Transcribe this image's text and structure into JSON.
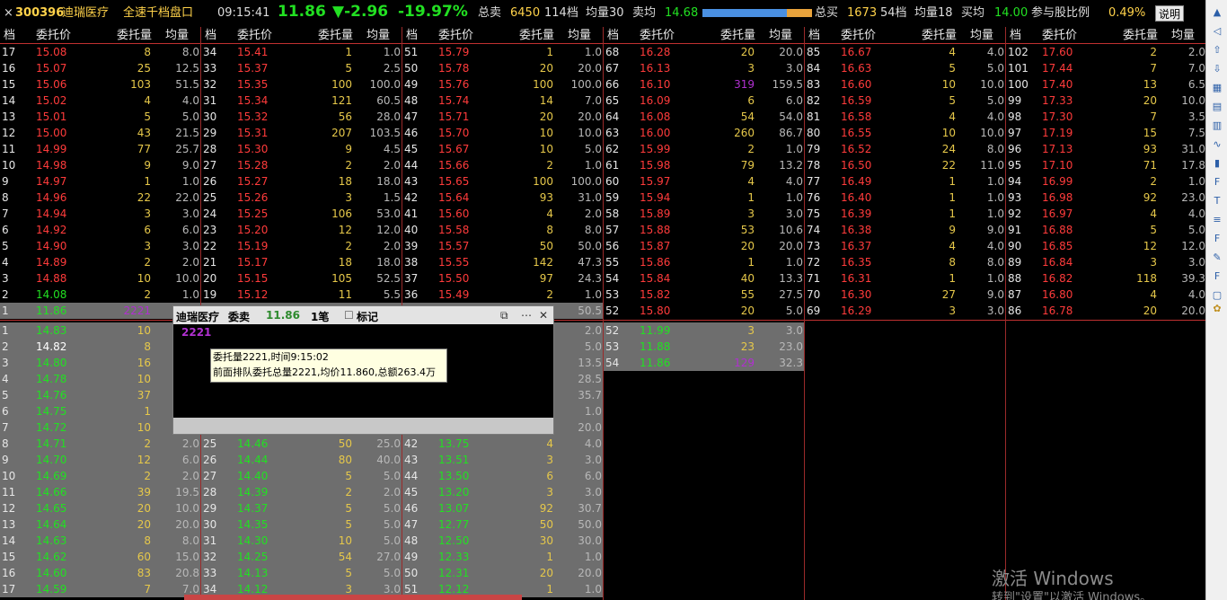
{
  "header": {
    "close": "×",
    "code": "300396",
    "name": "迪瑞医疗",
    "mode": "全速千档盘口",
    "time": "09:15:41",
    "price": "11.86",
    "change": "▼-2.96",
    "pct": "-19.97%",
    "sell_label": "总卖",
    "sell_total": "6450",
    "sell_levels": "114档",
    "sell_avg_label": "均量30",
    "sell_avgprice_label": "卖均",
    "sell_avgprice": "14.68",
    "buy_label": "总买",
    "buy_total": "1673",
    "buy_levels": "54档",
    "buy_avg_label": "均量18",
    "buy_avgprice_label": "买均",
    "buy_avgprice": "14.00",
    "part_label": "参与股比例",
    "part_value": "0.49%",
    "help": "说明",
    "ratio_bar": {
      "blue": 0.77,
      "orange": 0.23,
      "blue_color": "#4a90e2",
      "orange_color": "#e8a33c"
    }
  },
  "columns": [
    "档",
    "委托价",
    "委托量",
    "均量"
  ],
  "colors": {
    "up": "#ff3b3b",
    "down": "#22e022",
    "vol": "#e6c84a",
    "text": "#e6e6e6",
    "purple": "#b030d0",
    "grey_bg": "#6e6e6e"
  },
  "sell_rows": [
    [
      [
        17,
        "15.08",
        8,
        "8.0"
      ],
      [
        34,
        "15.41",
        1,
        "1.0"
      ],
      [
        51,
        "15.79",
        1,
        "1.0"
      ],
      [
        68,
        "16.28",
        20,
        "20.0"
      ],
      [
        85,
        "16.67",
        4,
        "4.0"
      ],
      [
        102,
        "17.60",
        2,
        "2.0"
      ]
    ],
    [
      [
        16,
        "15.07",
        25,
        "12.5"
      ],
      [
        33,
        "15.37",
        5,
        "2.5"
      ],
      [
        50,
        "15.78",
        20,
        "20.0"
      ],
      [
        67,
        "16.13",
        3,
        "3.0"
      ],
      [
        84,
        "16.63",
        5,
        "5.0"
      ],
      [
        101,
        "17.44",
        7,
        "7.0"
      ]
    ],
    [
      [
        15,
        "15.06",
        103,
        "51.5"
      ],
      [
        32,
        "15.35",
        100,
        "100.0"
      ],
      [
        49,
        "15.76",
        100,
        "100.0"
      ],
      [
        66,
        "16.10",
        319,
        "159.5"
      ],
      [
        83,
        "16.60",
        10,
        "10.0"
      ],
      [
        100,
        "17.40",
        13,
        "6.5"
      ]
    ],
    [
      [
        14,
        "15.02",
        4,
        "4.0"
      ],
      [
        31,
        "15.34",
        121,
        "60.5"
      ],
      [
        48,
        "15.74",
        14,
        "7.0"
      ],
      [
        65,
        "16.09",
        6,
        "6.0"
      ],
      [
        82,
        "16.59",
        5,
        "5.0"
      ],
      [
        99,
        "17.33",
        20,
        "10.0"
      ]
    ],
    [
      [
        13,
        "15.01",
        5,
        "5.0"
      ],
      [
        30,
        "15.32",
        56,
        "28.0"
      ],
      [
        47,
        "15.71",
        20,
        "20.0"
      ],
      [
        64,
        "16.08",
        54,
        "54.0"
      ],
      [
        81,
        "16.58",
        4,
        "4.0"
      ],
      [
        98,
        "17.30",
        7,
        "3.5"
      ]
    ],
    [
      [
        12,
        "15.00",
        43,
        "21.5"
      ],
      [
        29,
        "15.31",
        207,
        "103.5"
      ],
      [
        46,
        "15.70",
        10,
        "10.0"
      ],
      [
        63,
        "16.00",
        260,
        "86.7"
      ],
      [
        80,
        "16.55",
        10,
        "10.0"
      ],
      [
        97,
        "17.19",
        15,
        "7.5"
      ]
    ],
    [
      [
        11,
        "14.99",
        77,
        "25.7"
      ],
      [
        28,
        "15.30",
        9,
        "4.5"
      ],
      [
        45,
        "15.67",
        10,
        "5.0"
      ],
      [
        62,
        "15.99",
        2,
        "1.0"
      ],
      [
        79,
        "16.52",
        24,
        "8.0"
      ],
      [
        96,
        "17.13",
        93,
        "31.0"
      ]
    ],
    [
      [
        10,
        "14.98",
        9,
        "9.0"
      ],
      [
        27,
        "15.28",
        2,
        "2.0"
      ],
      [
        44,
        "15.66",
        2,
        "1.0"
      ],
      [
        61,
        "15.98",
        79,
        "13.2"
      ],
      [
        78,
        "16.50",
        22,
        "11.0"
      ],
      [
        95,
        "17.10",
        71,
        "17.8"
      ]
    ],
    [
      [
        9,
        "14.97",
        1,
        "1.0"
      ],
      [
        26,
        "15.27",
        18,
        "18.0"
      ],
      [
        43,
        "15.65",
        100,
        "100.0"
      ],
      [
        60,
        "15.97",
        4,
        "4.0"
      ],
      [
        77,
        "16.49",
        1,
        "1.0"
      ],
      [
        94,
        "16.99",
        2,
        "1.0"
      ]
    ],
    [
      [
        8,
        "14.96",
        22,
        "22.0"
      ],
      [
        25,
        "15.26",
        3,
        "1.5"
      ],
      [
        42,
        "15.64",
        93,
        "31.0"
      ],
      [
        59,
        "15.94",
        1,
        "1.0"
      ],
      [
        76,
        "16.40",
        1,
        "1.0"
      ],
      [
        93,
        "16.98",
        92,
        "23.0"
      ]
    ],
    [
      [
        7,
        "14.94",
        3,
        "3.0"
      ],
      [
        24,
        "15.25",
        106,
        "53.0"
      ],
      [
        41,
        "15.60",
        4,
        "2.0"
      ],
      [
        58,
        "15.89",
        3,
        "3.0"
      ],
      [
        75,
        "16.39",
        1,
        "1.0"
      ],
      [
        92,
        "16.97",
        4,
        "4.0"
      ]
    ],
    [
      [
        6,
        "14.92",
        6,
        "6.0"
      ],
      [
        23,
        "15.20",
        12,
        "12.0"
      ],
      [
        40,
        "15.58",
        8,
        "8.0"
      ],
      [
        57,
        "15.88",
        53,
        "10.6"
      ],
      [
        74,
        "16.38",
        9,
        "9.0"
      ],
      [
        91,
        "16.88",
        5,
        "5.0"
      ]
    ],
    [
      [
        5,
        "14.90",
        3,
        "3.0"
      ],
      [
        22,
        "15.19",
        2,
        "2.0"
      ],
      [
        39,
        "15.57",
        50,
        "50.0"
      ],
      [
        56,
        "15.87",
        20,
        "20.0"
      ],
      [
        73,
        "16.37",
        4,
        "4.0"
      ],
      [
        90,
        "16.85",
        12,
        "12.0"
      ]
    ],
    [
      [
        4,
        "14.89",
        2,
        "2.0"
      ],
      [
        21,
        "15.17",
        18,
        "18.0"
      ],
      [
        38,
        "15.55",
        142,
        "47.3"
      ],
      [
        55,
        "15.86",
        1,
        "1.0"
      ],
      [
        72,
        "16.35",
        8,
        "8.0"
      ],
      [
        89,
        "16.84",
        3,
        "3.0"
      ]
    ],
    [
      [
        3,
        "14.88",
        10,
        "10.0"
      ],
      [
        20,
        "15.15",
        105,
        "52.5"
      ],
      [
        37,
        "15.50",
        97,
        "24.3"
      ],
      [
        54,
        "15.84",
        40,
        "13.3"
      ],
      [
        71,
        "16.31",
        1,
        "1.0"
      ],
      [
        88,
        "16.82",
        118,
        "39.3"
      ]
    ],
    [
      [
        2,
        "14.08",
        2,
        "1.0"
      ],
      [
        19,
        "15.12",
        11,
        "5.5"
      ],
      [
        36,
        "15.49",
        2,
        "1.0"
      ],
      [
        53,
        "15.82",
        55,
        "27.5"
      ],
      [
        70,
        "16.30",
        27,
        "9.0"
      ],
      [
        87,
        "16.80",
        4,
        "4.0"
      ]
    ],
    [
      [
        1,
        "11.86",
        "2221",
        "2221"
      ],
      [
        18,
        "",
        null,
        ""
      ],
      [
        35,
        "",
        null,
        "50.5"
      ],
      [
        52,
        "15.80",
        20,
        "5.0"
      ],
      [
        69,
        "16.29",
        3,
        "3.0"
      ],
      [
        86,
        "16.78",
        20,
        "20.0"
      ]
    ]
  ],
  "buy_rows": [
    [
      [
        1,
        "14.83",
        10,
        ""
      ],
      [
        "",
        "",
        "",
        ""
      ],
      [
        "",
        "",
        "",
        "2.0"
      ],
      [
        52,
        "11.99",
        3,
        "3.0"
      ]
    ],
    [
      [
        2,
        "14.82",
        8,
        ""
      ],
      [
        "",
        "",
        "",
        ""
      ],
      [
        "",
        "",
        "",
        "5.0"
      ],
      [
        53,
        "11.88",
        23,
        "23.0"
      ]
    ],
    [
      [
        3,
        "14.80",
        16,
        ""
      ],
      [
        "",
        "",
        "",
        ""
      ],
      [
        "",
        "",
        "",
        "13.5"
      ],
      [
        54,
        "11.86",
        129,
        "32.3"
      ]
    ],
    [
      [
        4,
        "14.78",
        10,
        ""
      ],
      [
        "",
        "",
        "",
        ""
      ],
      [
        "",
        "",
        "",
        "28.5"
      ],
      [
        "",
        "",
        "",
        ""
      ]
    ],
    [
      [
        5,
        "14.76",
        37,
        ""
      ],
      [
        "",
        "",
        "",
        ""
      ],
      [
        "",
        "",
        "",
        "35.7"
      ],
      [
        "",
        "",
        "",
        ""
      ]
    ],
    [
      [
        6,
        "14.75",
        1,
        ""
      ],
      [
        "",
        "",
        "",
        ""
      ],
      [
        "",
        "",
        "",
        "1.0"
      ],
      [
        "",
        "",
        "",
        ""
      ]
    ],
    [
      [
        7,
        "14.72",
        10,
        ""
      ],
      [
        "",
        "",
        "",
        ""
      ],
      [
        "",
        "",
        "",
        "20.0"
      ],
      [
        "",
        "",
        "",
        ""
      ]
    ],
    [
      [
        8,
        "14.71",
        2,
        "2.0"
      ],
      [
        25,
        "14.46",
        50,
        "25.0"
      ],
      [
        42,
        "13.75",
        4,
        "4.0"
      ],
      [
        "",
        "",
        "",
        ""
      ]
    ],
    [
      [
        9,
        "14.70",
        12,
        "6.0"
      ],
      [
        26,
        "14.44",
        80,
        "40.0"
      ],
      [
        43,
        "13.51",
        3,
        "3.0"
      ],
      [
        "",
        "",
        "",
        ""
      ]
    ],
    [
      [
        10,
        "14.69",
        2,
        "2.0"
      ],
      [
        27,
        "14.40",
        5,
        "5.0"
      ],
      [
        44,
        "13.50",
        6,
        "6.0"
      ],
      [
        "",
        "",
        "",
        ""
      ]
    ],
    [
      [
        11,
        "14.66",
        39,
        "19.5"
      ],
      [
        28,
        "14.39",
        2,
        "2.0"
      ],
      [
        45,
        "13.20",
        3,
        "3.0"
      ],
      [
        "",
        "",
        "",
        ""
      ]
    ],
    [
      [
        12,
        "14.65",
        20,
        "10.0"
      ],
      [
        29,
        "14.37",
        5,
        "5.0"
      ],
      [
        46,
        "13.07",
        92,
        "30.7"
      ],
      [
        "",
        "",
        "",
        ""
      ]
    ],
    [
      [
        13,
        "14.64",
        20,
        "20.0"
      ],
      [
        30,
        "14.35",
        5,
        "5.0"
      ],
      [
        47,
        "12.77",
        50,
        "50.0"
      ],
      [
        "",
        "",
        "",
        ""
      ]
    ],
    [
      [
        14,
        "14.63",
        8,
        "8.0"
      ],
      [
        31,
        "14.30",
        10,
        "5.0"
      ],
      [
        48,
        "12.50",
        30,
        "30.0"
      ],
      [
        "",
        "",
        "",
        ""
      ]
    ],
    [
      [
        15,
        "14.62",
        60,
        "15.0"
      ],
      [
        32,
        "14.25",
        54,
        "27.0"
      ],
      [
        49,
        "12.33",
        1,
        "1.0"
      ],
      [
        "",
        "",
        "",
        ""
      ]
    ],
    [
      [
        16,
        "14.60",
        83,
        "20.8"
      ],
      [
        33,
        "14.13",
        5,
        "5.0"
      ],
      [
        50,
        "12.31",
        20,
        "20.0"
      ],
      [
        "",
        "",
        "",
        ""
      ]
    ],
    [
      [
        17,
        "14.59",
        7,
        "7.0"
      ],
      [
        34,
        "14.12",
        3,
        "3.0"
      ],
      [
        51,
        "12.12",
        1,
        "1.0"
      ],
      [
        "",
        "",
        "",
        ""
      ]
    ]
  ],
  "popup": {
    "title": "迪瑞医疗",
    "type": "委卖",
    "price": "11.86",
    "count": "1笔",
    "mark": "标记",
    "qty": "2221",
    "tip_line1": "委托量2221,时间9:15:02",
    "tip_line2": "前面排队委托总量2221,均价11.860,总额263.4万"
  },
  "sidebar": {
    "icons": [
      "scroll-up-icon",
      "arrow-left-icon",
      "arrow-up-icon",
      "arrow-down-icon",
      "chart-icon",
      "grid-icon",
      "table-icon",
      "line-icon",
      "kline-icon",
      "f10-icon",
      "text-icon",
      "list-icon",
      "f10b-icon",
      "note-icon",
      "f7-icon",
      "window-icon",
      "gear-icon"
    ]
  },
  "watermark": {
    "line1": "激活 Windows",
    "line2": "转到\"设置\"以激活 Windows。"
  }
}
